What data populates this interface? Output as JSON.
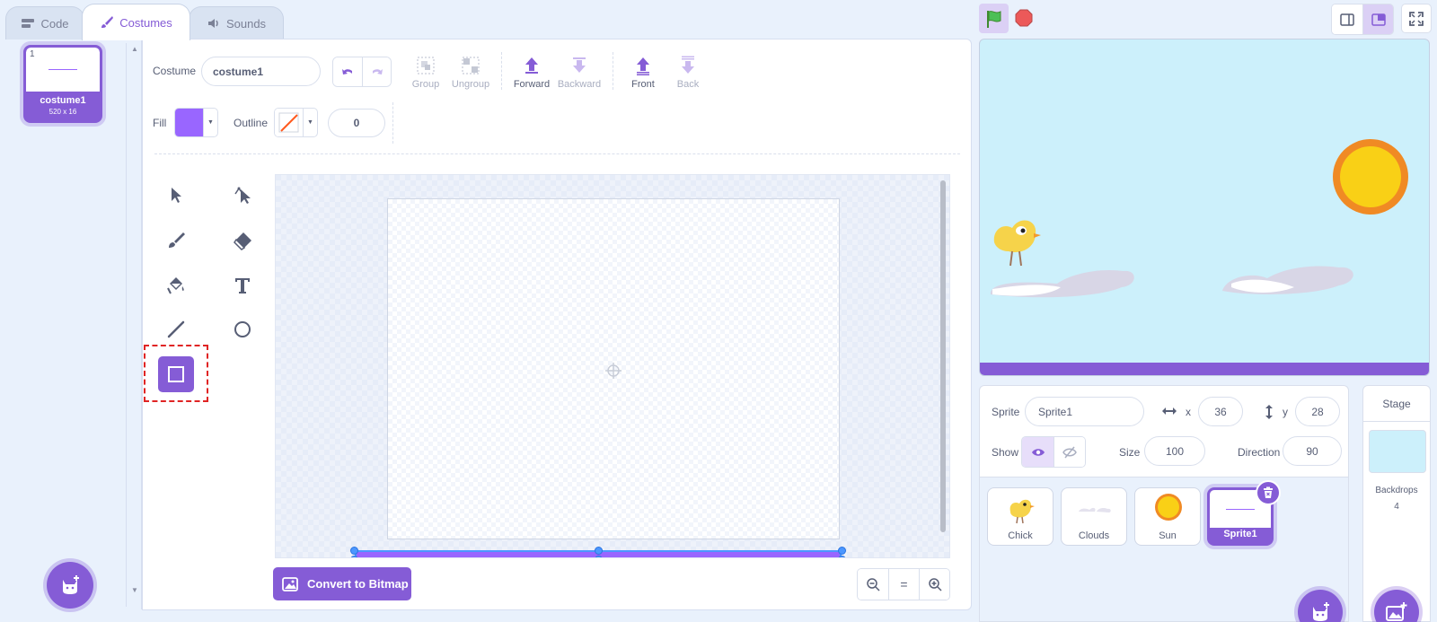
{
  "tabs": [
    {
      "label": "Code"
    },
    {
      "label": "Costumes"
    },
    {
      "label": "Sounds"
    }
  ],
  "costume_list": {
    "items": [
      {
        "number": "1",
        "name": "costume1",
        "dims": "520 x 16"
      }
    ]
  },
  "editor": {
    "costume_label": "Costume",
    "costume_name": "costume1",
    "actions": {
      "group": "Group",
      "ungroup": "Ungroup",
      "forward": "Forward",
      "backward": "Backward",
      "front": "Front",
      "back": "Back"
    },
    "fill_label": "Fill",
    "fill_color": "#9966ff",
    "outline_label": "Outline",
    "outline_width": "0",
    "convert_label": "Convert to Bitmap",
    "zoom_reset": "="
  },
  "tools": [
    {
      "icon": "select-icon"
    },
    {
      "icon": "reshape-icon"
    },
    {
      "icon": "brush-icon"
    },
    {
      "icon": "eraser-icon"
    },
    {
      "icon": "fill-icon"
    },
    {
      "icon": "text-icon"
    },
    {
      "icon": "line-icon"
    },
    {
      "icon": "circle-icon"
    },
    {
      "icon": "rectangle-icon",
      "selected": true
    }
  ],
  "sprite_info": {
    "sprite_label": "Sprite",
    "sprite_name": "Sprite1",
    "x_label": "x",
    "x_value": "36",
    "y_label": "y",
    "y_value": "28",
    "show_label": "Show",
    "size_label": "Size",
    "size_value": "100",
    "direction_label": "Direction",
    "direction_value": "90"
  },
  "sprites": [
    {
      "name": "Chick"
    },
    {
      "name": "Clouds"
    },
    {
      "name": "Sun"
    },
    {
      "name": "Sprite1",
      "selected": true
    }
  ],
  "stage_panel": {
    "title": "Stage",
    "backdrops_label": "Backdrops",
    "backdrops_count": "4"
  },
  "colors": {
    "accent": "#855cd6",
    "fill": "#9966ff",
    "stage_bg": "#ccf0fb",
    "selection": "#4c97ff",
    "highlight": "#e02424"
  }
}
